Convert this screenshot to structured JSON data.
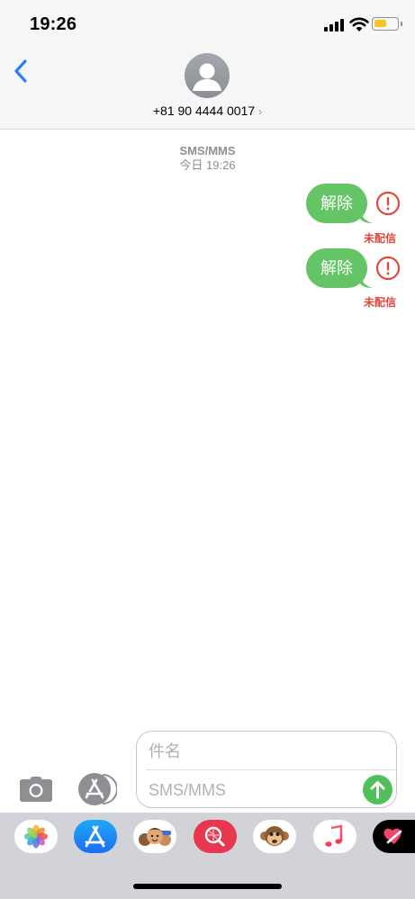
{
  "status_bar": {
    "time": "19:26",
    "battery_level": 0.55,
    "battery_color": "#f4c42b"
  },
  "header": {
    "back_icon": "chevron-left-icon",
    "avatar_icon": "person-silhouette-icon",
    "contact_name": "+81 90 4444 0017",
    "contact_chevron": "›",
    "accent_color": "#2f7cf6"
  },
  "conversation": {
    "service": "SMS/MMS",
    "timestamp": "今日 19:26",
    "messages": [
      {
        "text": "解除",
        "status": "未配信",
        "error_icon": "exclamation-circle-icon"
      },
      {
        "text": "解除",
        "status": "未配信",
        "error_icon": "exclamation-circle-icon"
      }
    ],
    "bubble_color": "#65c466",
    "error_color": "#e0473d"
  },
  "compose": {
    "camera_icon": "camera-icon",
    "apps_icon": "app-store-icon",
    "subject_placeholder": "件名",
    "message_placeholder": "SMS/MMS",
    "send_icon": "arrow-up-icon",
    "send_color": "#52c05a"
  },
  "app_drawer": {
    "apps": [
      {
        "icon": "photos-icon"
      },
      {
        "icon": "app-store-icon"
      },
      {
        "icon": "memoji-icon"
      },
      {
        "icon": "search-images-icon"
      },
      {
        "icon": "animoji-monkey-icon"
      },
      {
        "icon": "music-icon"
      },
      {
        "icon": "digital-touch-icon"
      }
    ]
  }
}
